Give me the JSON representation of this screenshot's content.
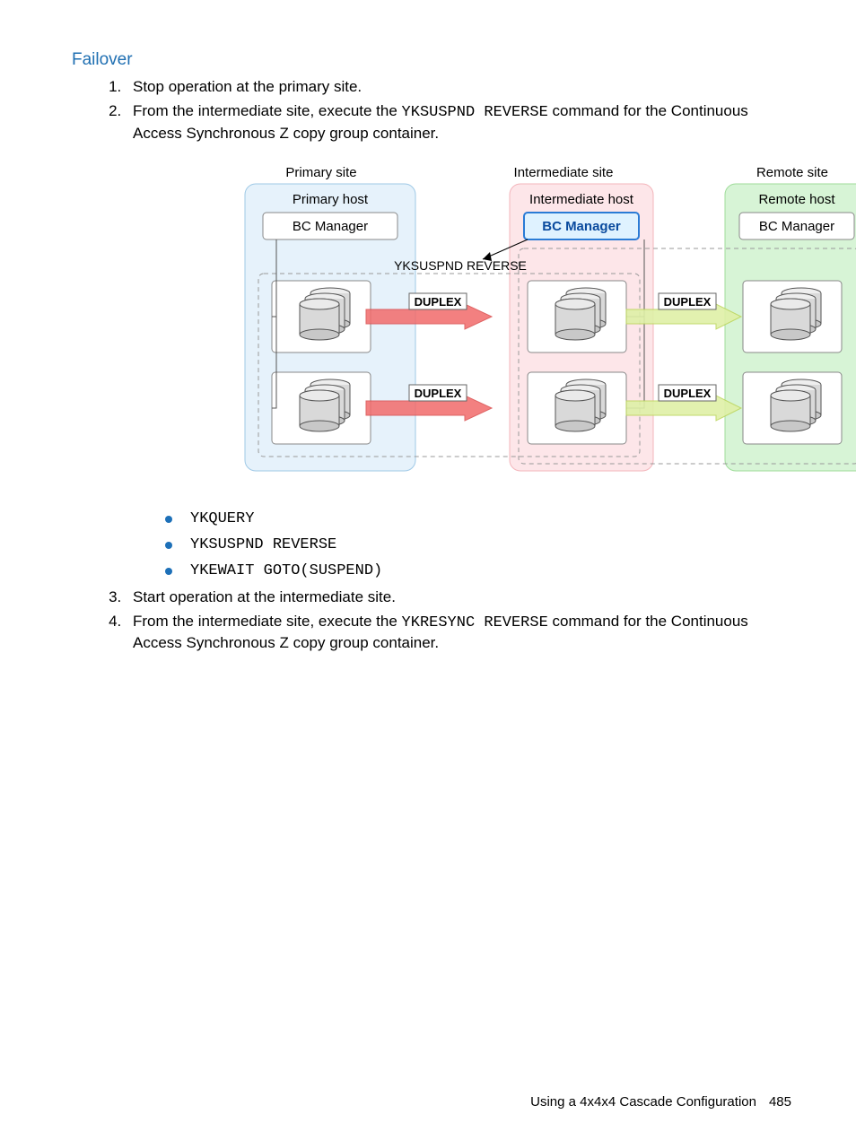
{
  "heading": "Failover",
  "steps": {
    "s1": "Stop operation at the primary site.",
    "s2_pre": "From the intermediate site, execute the ",
    "s2_cmd": "YKSUSPND REVERSE",
    "s2_post": " command for the Continuous Access Synchronous Z copy group container.",
    "s3": "Start operation at the intermediate site.",
    "s4_pre": "From the intermediate site, execute the ",
    "s4_cmd": "YKRESYNC REVERSE",
    "s4_post": " command for the Continuous Access Synchronous Z copy group container."
  },
  "cmd_list": {
    "c1": "YKQUERY",
    "c2": "YKSUSPND REVERSE",
    "c3": "YKEWAIT GOTO(SUSPEND)"
  },
  "diagram": {
    "primary_site": "Primary site",
    "intermediate_site": "Intermediate site",
    "remote_site": "Remote site",
    "primary_host": "Primary host",
    "intermediate_host": "Intermediate host",
    "remote_host": "Remote host",
    "bc_manager": "BC Manager",
    "bc_manager_bold": "BC Manager",
    "arrow_label": "YKSUSPND REVERSE",
    "duplex": "DUPLEX"
  },
  "footer": {
    "text": "Using a 4x4x4 Cascade Configuration",
    "page": "485"
  }
}
